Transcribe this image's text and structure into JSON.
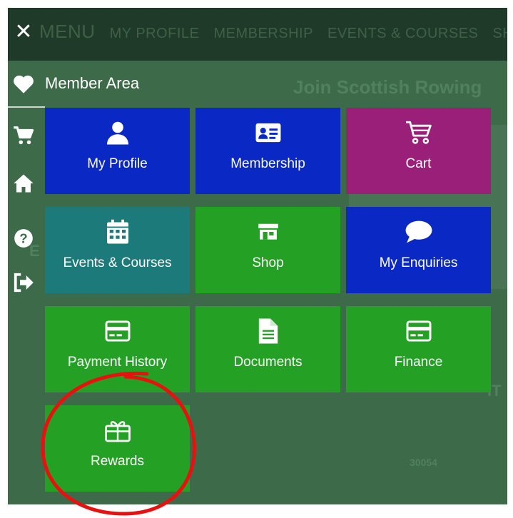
{
  "topbar": {
    "close_icon": "close-icon",
    "ghost_nav": [
      "MENU",
      "MY PROFILE",
      "MEMBERSHIP",
      "EVENTS & COURSES",
      "SHOP"
    ]
  },
  "background": {
    "title": "Join Scottish Rowing",
    "fragment_e": "E",
    "fragment_it": "IT",
    "number": "30054"
  },
  "sidebar": {
    "items": [
      {
        "icon": "heart-icon"
      },
      {
        "icon": "cart-icon"
      },
      {
        "icon": "home-icon"
      },
      {
        "icon": "help-icon"
      },
      {
        "icon": "logout-icon"
      }
    ]
  },
  "menu": {
    "title": "Member Area",
    "tiles": [
      {
        "label": "My Profile",
        "icon": "user-icon",
        "color": "#0a28c4"
      },
      {
        "label": "Membership",
        "icon": "id-card-icon",
        "color": "#0a28c4"
      },
      {
        "label": "Cart",
        "icon": "cart-icon",
        "color": "#9a1f78"
      },
      {
        "label": "Events & Courses",
        "icon": "calendar-icon",
        "color": "#1d7a7a"
      },
      {
        "label": "Shop",
        "icon": "store-icon",
        "color": "#24a124"
      },
      {
        "label": "My Enquiries",
        "icon": "chat-icon",
        "color": "#0a28c4"
      },
      {
        "label": "Payment History",
        "icon": "credit-card-icon",
        "color": "#24a124"
      },
      {
        "label": "Documents",
        "icon": "document-icon",
        "color": "#24a124"
      },
      {
        "label": "Finance",
        "icon": "credit-card-icon",
        "color": "#24a124"
      },
      {
        "label": "Rewards",
        "icon": "gift-icon",
        "color": "#24a124"
      }
    ]
  },
  "annotation": {
    "color": "#e8110f"
  }
}
